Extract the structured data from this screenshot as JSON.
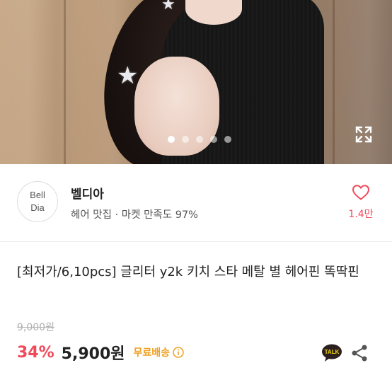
{
  "product_image": {
    "icon": "expand-icon",
    "carousel": {
      "count": 5,
      "active_index": 0
    }
  },
  "shop": {
    "logo_line1": "Bell",
    "logo_line2": "Dia",
    "name": "벨디아",
    "meta": "헤어 맛집 · 마켓 만족도 97%",
    "favorite_count": "1.4만",
    "favorite_icon": "heart-icon"
  },
  "product": {
    "title": "[최저가/6,10pcs] 글리터 y2k 키치 스타 메탈 별 헤어핀 똑딱핀",
    "original_price": "9,000원",
    "discount": "34%",
    "price": "5,900원",
    "shipping": "무료배송",
    "info_icon": "info-icon"
  },
  "actions": {
    "talk_label": "TALK",
    "talk_icon": "kakaotalk-icon",
    "share_icon": "share-icon"
  },
  "colors": {
    "accent": "#f14a5a",
    "shipping": "#f0a020",
    "talk_bg": "#2b1f1f"
  }
}
